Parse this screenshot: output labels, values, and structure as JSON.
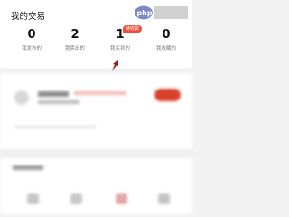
{
  "my_trades": {
    "title": "我的交易",
    "stats": [
      {
        "count": "0",
        "label": "我发布的"
      },
      {
        "count": "2",
        "label": "我卖出的"
      },
      {
        "count": "1",
        "label": "我买到的",
        "badge": "待收货"
      },
      {
        "count": "0",
        "label": "我收藏的"
      }
    ]
  },
  "watermark": {
    "text": "php中文网"
  },
  "colors": {
    "accent": "#e8503a",
    "arrow": "#a01616"
  }
}
